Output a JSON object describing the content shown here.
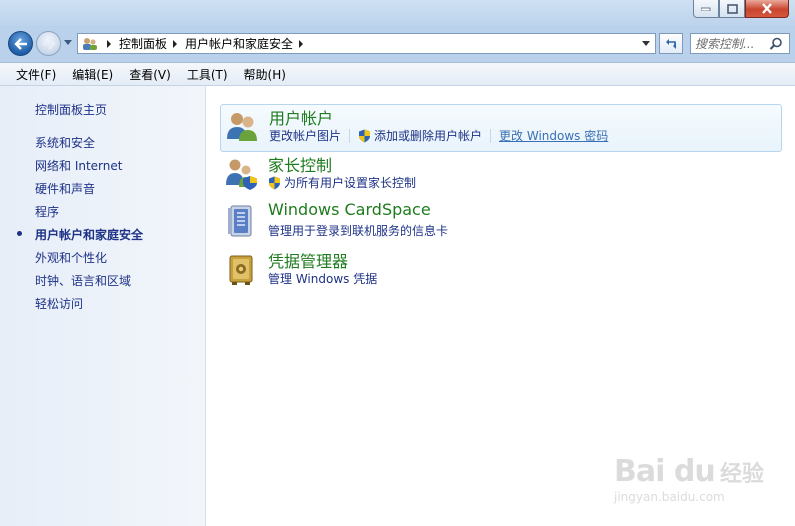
{
  "window": {
    "caption_buttons": [
      "minimize",
      "maximize",
      "close"
    ]
  },
  "address": {
    "breadcrumbs": [
      "控制面板",
      "用户帐户和家庭安全"
    ]
  },
  "search": {
    "placeholder": "搜索控制..."
  },
  "menu": {
    "items": [
      "文件(F)",
      "编辑(E)",
      "查看(V)",
      "工具(T)",
      "帮助(H)"
    ]
  },
  "sidebar": {
    "home": "控制面板主页",
    "items": [
      {
        "label": "系统和安全"
      },
      {
        "label": "网络和 Internet"
      },
      {
        "label": "硬件和声音"
      },
      {
        "label": "程序"
      },
      {
        "label": "用户帐户和家庭安全",
        "current": true
      },
      {
        "label": "外观和个性化"
      },
      {
        "label": "时钟、语言和区域"
      },
      {
        "label": "轻松访问"
      }
    ]
  },
  "categories": [
    {
      "title": "用户帐户",
      "icon": "users-icon",
      "links": [
        {
          "label": "更改帐户图片",
          "shield": false
        },
        {
          "label": "添加或删除用户帐户",
          "shield": true
        },
        {
          "label": "更改 Windows 密码",
          "shield": false,
          "hovered": true
        }
      ]
    },
    {
      "title": "家长控制",
      "icon": "parental-controls-icon",
      "links": [
        {
          "label": "为所有用户设置家长控制",
          "shield": true
        }
      ]
    },
    {
      "title": "Windows CardSpace",
      "icon": "cardspace-icon",
      "links": [
        {
          "label": "管理用于登录到联机服务的信息卡",
          "shield": false
        }
      ]
    },
    {
      "title": "凭据管理器",
      "icon": "credential-vault-icon",
      "links": [
        {
          "label": "管理 Windows 凭据",
          "shield": false
        }
      ]
    }
  ],
  "watermark": {
    "brand": "Bai du",
    "brand_cn": "经验",
    "url": "jingyan.baidu.com"
  }
}
